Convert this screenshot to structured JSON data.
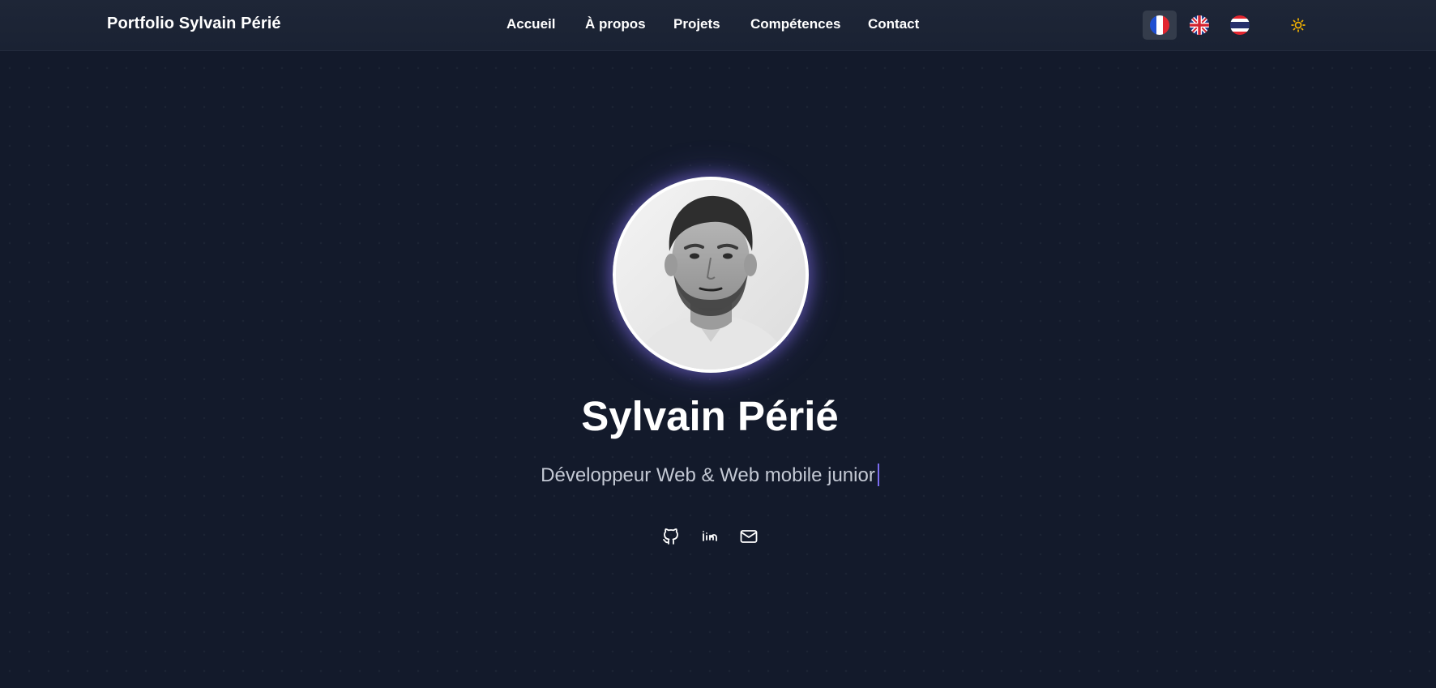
{
  "header": {
    "brand": "Portfolio Sylvain Périé",
    "nav": [
      {
        "label": "Accueil"
      },
      {
        "label": "À propos"
      },
      {
        "label": "Projets"
      },
      {
        "label": "Compétences"
      },
      {
        "label": "Contact"
      }
    ],
    "languages": [
      {
        "icon": "flag-fr-icon",
        "active": true
      },
      {
        "icon": "flag-uk-icon",
        "active": false
      },
      {
        "icon": "flag-th-icon",
        "active": false
      }
    ],
    "theme_toggle_icon": "sun-icon"
  },
  "hero": {
    "name": "Sylvain Périé",
    "subtitle": "Développeur Web & Web mobile junior",
    "avatar_icon": "profile-photo",
    "social": [
      {
        "icon": "github-icon"
      },
      {
        "icon": "linkedin-icon"
      },
      {
        "icon": "mail-icon"
      }
    ]
  },
  "colors": {
    "background": "#131a2b",
    "navbar": "#1e2637",
    "accent": "#7b6cf0",
    "sun": "#f5b400"
  }
}
